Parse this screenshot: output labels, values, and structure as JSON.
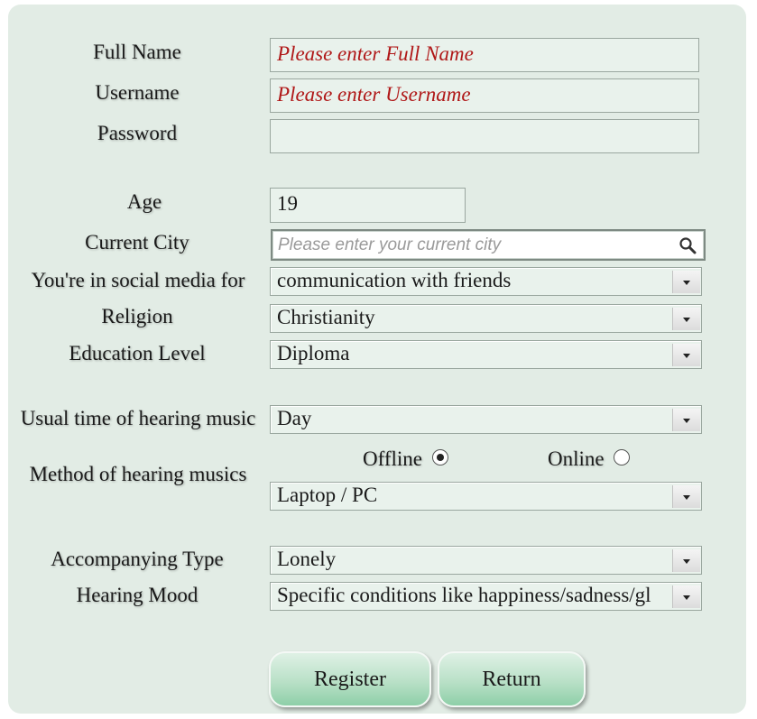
{
  "form": {
    "full_name": {
      "label": "Full Name",
      "placeholder": "Please enter Full Name",
      "value": ""
    },
    "username": {
      "label": "Username",
      "placeholder": "Please enter Username",
      "value": ""
    },
    "password": {
      "label": "Password",
      "value": ""
    },
    "age": {
      "label": "Age",
      "value": "19"
    },
    "current_city": {
      "label": "Current City",
      "placeholder": "Please enter your current city",
      "icon": "search-icon"
    },
    "social_media": {
      "label": "You're in social media for",
      "value": "communication with friends"
    },
    "religion": {
      "label": "Religion",
      "value": "Christianity"
    },
    "education": {
      "label": "Education Level",
      "value": "Diploma"
    },
    "music_time": {
      "label": "Usual time of hearing music",
      "value": "Day"
    },
    "music_method": {
      "label": "Method of hearing musics",
      "offline_label": "Offline",
      "online_label": "Online",
      "selected": "Offline",
      "device": "Laptop / PC"
    },
    "accompanying": {
      "label": "Accompanying Type",
      "value": "Lonely"
    },
    "mood": {
      "label": "Hearing Mood",
      "value": "Specific conditions like happiness/sadness/gl"
    }
  },
  "buttons": {
    "register": "Register",
    "return": "Return"
  },
  "colors": {
    "panel": "#e2ece5",
    "placeholder": "#b01818",
    "button_green": "#8ecfa8"
  }
}
